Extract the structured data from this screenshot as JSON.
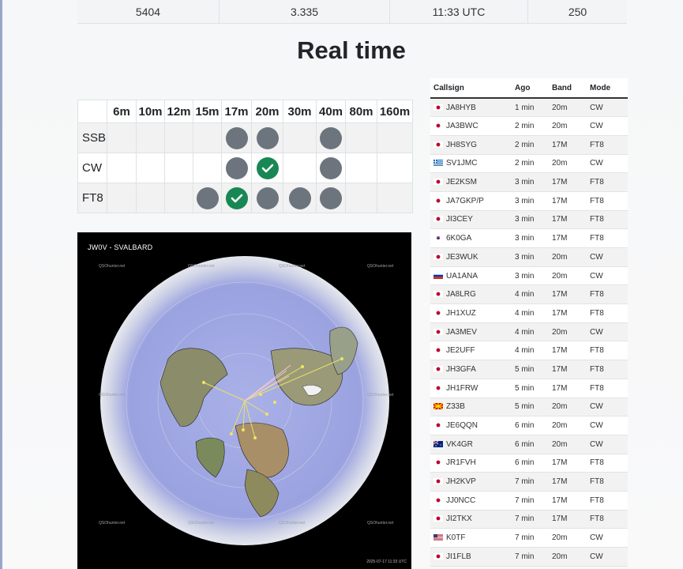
{
  "stats": [
    "5404",
    "3.335",
    "11:33 UTC",
    "250"
  ],
  "title": "Real time",
  "bands": [
    "6m",
    "10m",
    "12m",
    "15m",
    "17m",
    "20m",
    "30m",
    "40m",
    "80m",
    "160m"
  ],
  "modes": [
    {
      "label": "SSB",
      "cells": [
        "",
        "",
        "",
        "",
        "grey",
        "grey",
        "",
        "grey",
        "",
        ""
      ]
    },
    {
      "label": "CW",
      "cells": [
        "",
        "",
        "",
        "",
        "grey",
        "check",
        "",
        "grey",
        "",
        ""
      ]
    },
    {
      "label": "FT8",
      "cells": [
        "",
        "",
        "",
        "grey",
        "check",
        "grey",
        "grey",
        "grey",
        "",
        ""
      ]
    }
  ],
  "map": {
    "title": "JW0V - SVALBARD",
    "watermark": "QSOhunter.net",
    "timestamp": "2025-07-17 11:33 UTC"
  },
  "spots": {
    "headers": {
      "callsign": "Callsign",
      "ago": "Ago",
      "band": "Band",
      "mode": "Mode"
    },
    "rows": [
      {
        "flag": "jp",
        "call": "JA8HYB",
        "ago": "1 min",
        "band": "20m",
        "mode": "CW"
      },
      {
        "flag": "jp",
        "call": "JA3BWC",
        "ago": "2 min",
        "band": "20m",
        "mode": "CW"
      },
      {
        "flag": "jp",
        "call": "JH8SYG",
        "ago": "2 min",
        "band": "17M",
        "mode": "FT8"
      },
      {
        "flag": "gr",
        "call": "SV1JMC",
        "ago": "2 min",
        "band": "20m",
        "mode": "CW"
      },
      {
        "flag": "jp",
        "call": "JE2KSM",
        "ago": "3 min",
        "band": "17M",
        "mode": "FT8"
      },
      {
        "flag": "jp",
        "call": "JA7GKP/P",
        "ago": "3 min",
        "band": "17M",
        "mode": "FT8"
      },
      {
        "flag": "jp",
        "call": "JI3CEY",
        "ago": "3 min",
        "band": "17M",
        "mode": "FT8"
      },
      {
        "flag": "kr",
        "call": "6K0GA",
        "ago": "3 min",
        "band": "17M",
        "mode": "FT8"
      },
      {
        "flag": "jp",
        "call": "JE3WUK",
        "ago": "3 min",
        "band": "20m",
        "mode": "CW"
      },
      {
        "flag": "ru",
        "call": "UA1ANA",
        "ago": "3 min",
        "band": "20m",
        "mode": "CW"
      },
      {
        "flag": "jp",
        "call": "JA8LRG",
        "ago": "4 min",
        "band": "17M",
        "mode": "FT8"
      },
      {
        "flag": "jp",
        "call": "JH1XUZ",
        "ago": "4 min",
        "band": "17M",
        "mode": "FT8"
      },
      {
        "flag": "jp",
        "call": "JA3MEV",
        "ago": "4 min",
        "band": "20m",
        "mode": "CW"
      },
      {
        "flag": "jp",
        "call": "JE2UFF",
        "ago": "4 min",
        "band": "17M",
        "mode": "FT8"
      },
      {
        "flag": "jp",
        "call": "JH3GFA",
        "ago": "5 min",
        "band": "17M",
        "mode": "FT8"
      },
      {
        "flag": "jp",
        "call": "JH1FRW",
        "ago": "5 min",
        "band": "17M",
        "mode": "FT8"
      },
      {
        "flag": "mk",
        "call": "Z33B",
        "ago": "5 min",
        "band": "20m",
        "mode": "CW"
      },
      {
        "flag": "jp",
        "call": "JE6QQN",
        "ago": "6 min",
        "band": "20m",
        "mode": "CW"
      },
      {
        "flag": "au",
        "call": "VK4GR",
        "ago": "6 min",
        "band": "20m",
        "mode": "CW"
      },
      {
        "flag": "jp",
        "call": "JR1FVH",
        "ago": "6 min",
        "band": "17M",
        "mode": "FT8"
      },
      {
        "flag": "jp",
        "call": "JH2KVP",
        "ago": "7 min",
        "band": "17M",
        "mode": "FT8"
      },
      {
        "flag": "jp",
        "call": "JJ0NCC",
        "ago": "7 min",
        "band": "17M",
        "mode": "FT8"
      },
      {
        "flag": "jp",
        "call": "JI2TKX",
        "ago": "7 min",
        "band": "17M",
        "mode": "FT8"
      },
      {
        "flag": "us",
        "call": "K0TF",
        "ago": "7 min",
        "band": "20m",
        "mode": "CW"
      },
      {
        "flag": "jp",
        "call": "JI1FLB",
        "ago": "7 min",
        "band": "20m",
        "mode": "CW"
      }
    ]
  }
}
